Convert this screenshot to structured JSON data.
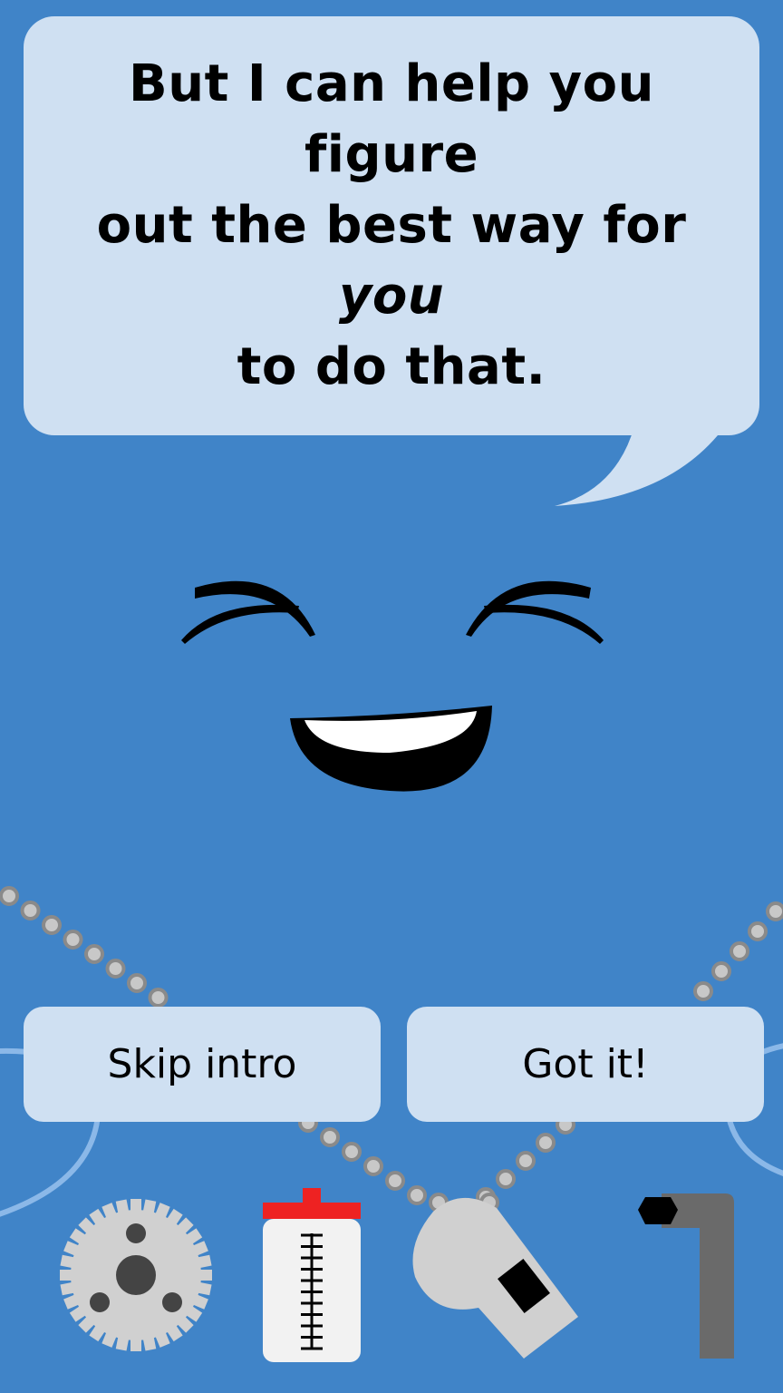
{
  "speech": {
    "line1": "But I can help you figure",
    "line2_pre": "out the best way for ",
    "line2_em": "you",
    "line3": "to do that."
  },
  "buttons": {
    "skip_label": "Skip intro",
    "got_it_label": "Got it!"
  },
  "colors": {
    "background": "#4084c8",
    "bubble": "#cfe0f2",
    "button": "#cfe0f2",
    "tool_gray": "#d0d0d0",
    "bottle_cap": "#ee2222"
  },
  "toolbar": {
    "icons": [
      "gear-icon",
      "water-bottle-icon",
      "whistle-icon",
      "hex-key-icon"
    ]
  }
}
